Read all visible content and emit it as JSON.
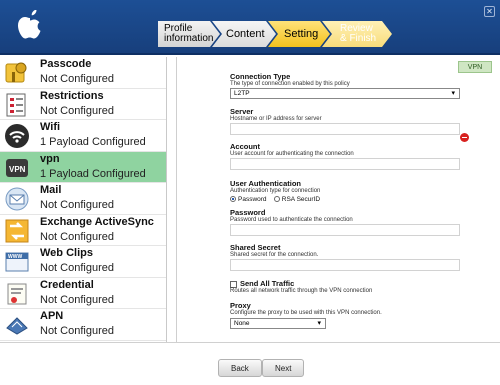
{
  "header": {
    "steps": [
      {
        "label": "Profile information"
      },
      {
        "label": "Content"
      },
      {
        "label": "Setting"
      },
      {
        "label": "Review & Finish"
      }
    ],
    "close_icon": "✕"
  },
  "sidebar": {
    "items": [
      {
        "name": "Passcode",
        "status": "Not Configured",
        "icon": "passcode-icon"
      },
      {
        "name": "Restrictions",
        "status": "Not Configured",
        "icon": "restrictions-icon"
      },
      {
        "name": "Wifi",
        "status": "1 Payload Configured",
        "icon": "wifi-icon"
      },
      {
        "name": "vpn",
        "status": "1 Payload Configured",
        "icon": "vpn-icon"
      },
      {
        "name": "Mail",
        "status": "Not Configured",
        "icon": "mail-icon"
      },
      {
        "name": "Exchange ActiveSync",
        "status": "Not Configured",
        "icon": "exchange-icon"
      },
      {
        "name": "Web Clips",
        "status": "Not Configured",
        "icon": "web-clips-icon"
      },
      {
        "name": "Credential",
        "status": "Not Configured",
        "icon": "credential-icon"
      },
      {
        "name": "APN",
        "status": "Not Configured",
        "icon": "apn-icon"
      }
    ]
  },
  "main": {
    "vpn_tab": "VPN",
    "connection_type": {
      "title": "Connection Type",
      "desc": "The type of connection enabled by this policy",
      "value": "L2TP"
    },
    "server": {
      "title": "Server",
      "desc": "Hostname or IP address for server",
      "value": ""
    },
    "account": {
      "title": "Account",
      "desc": "User account for authenticating the connection",
      "value": ""
    },
    "user_auth": {
      "title": "User Authentication",
      "desc": "Authentication type for connection",
      "opt_password": "Password",
      "opt_rsa": "RSA SecurID"
    },
    "password": {
      "title": "Password",
      "desc": "Password used to authenticate the connection",
      "value": ""
    },
    "shared_secret": {
      "title": "Shared Secret",
      "desc": "Shared secret for the connection.",
      "value": ""
    },
    "send_all": {
      "title": "Send All Traffic",
      "desc": "Routes all network traffic through the VPN connection"
    },
    "proxy": {
      "title": "Proxy",
      "desc": "Configure the proxy to be used with this VPN connection.",
      "value": "None"
    }
  },
  "footer": {
    "back": "Back",
    "next": "Next"
  }
}
